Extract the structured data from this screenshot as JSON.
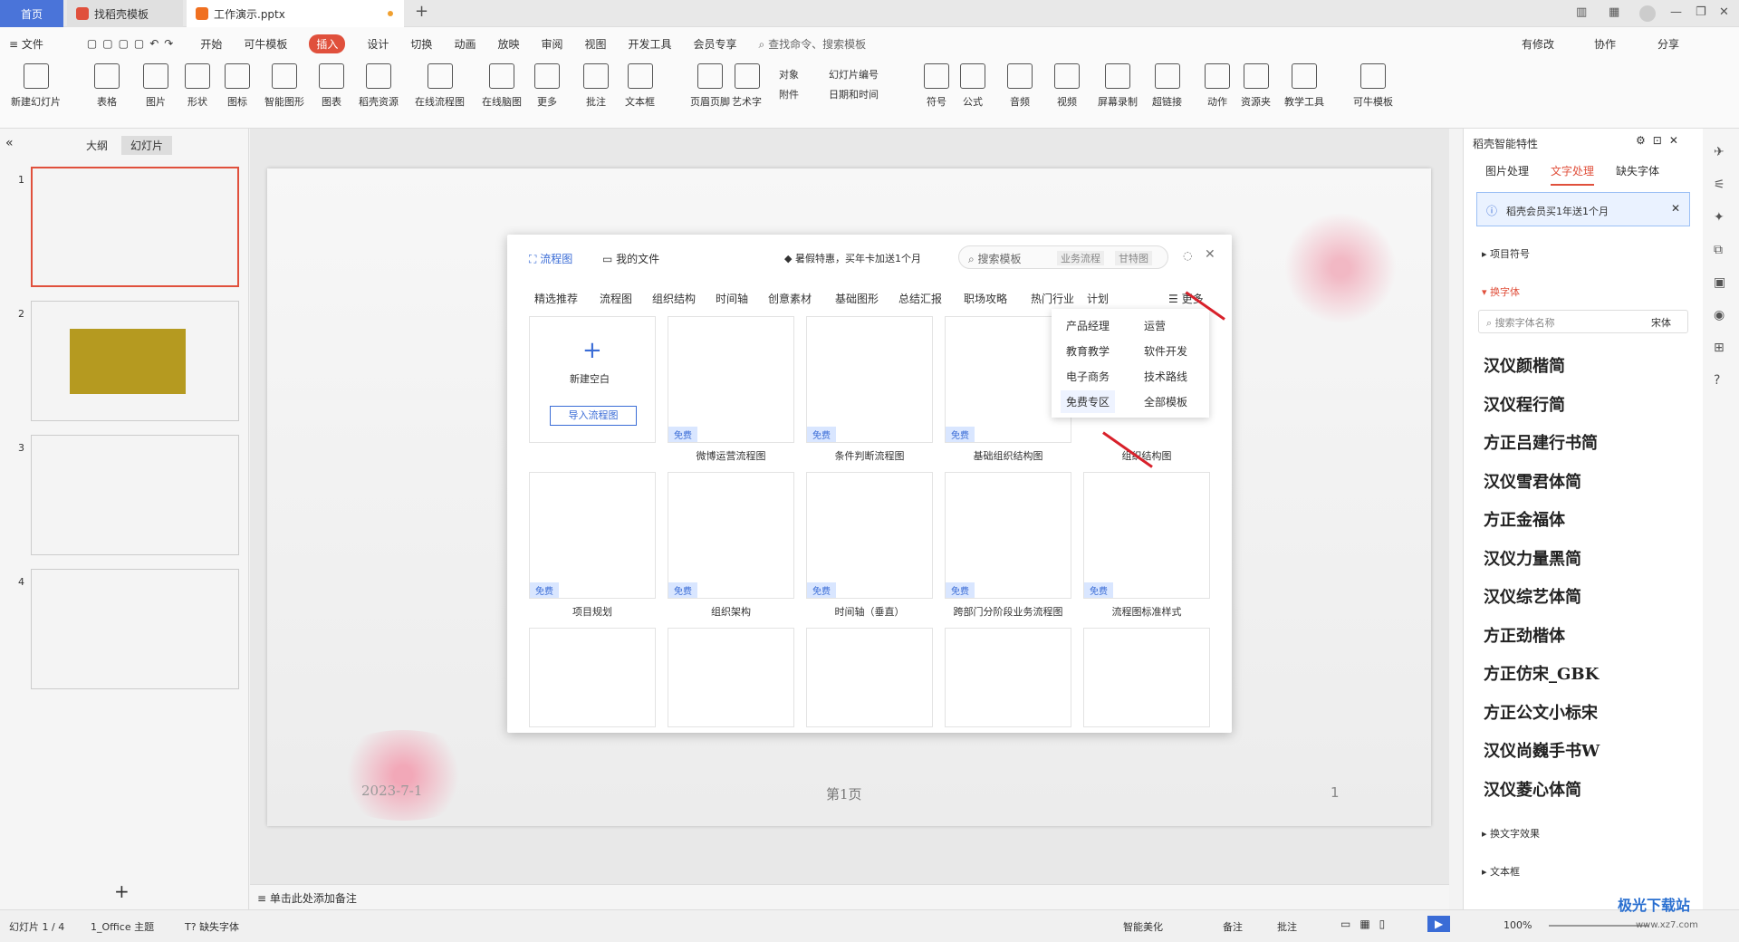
{
  "tabs": {
    "home": "首页",
    "t1": "找稻壳模板",
    "t2": "工作演示.pptx"
  },
  "menu": {
    "file": "文件",
    "items": [
      "开始",
      "可牛模板",
      "插入",
      "设计",
      "切换",
      "动画",
      "放映",
      "审阅",
      "视图",
      "开发工具",
      "会员专享"
    ],
    "search": "查找命令、搜索模板",
    "modified": "有修改",
    "collab": "协作",
    "share": "分享"
  },
  "ribbon": [
    "新建幻灯片",
    "表格",
    "图片",
    "形状",
    "图标",
    "智能图形",
    "图表",
    "稻壳资源",
    "在线流程图",
    "在线脑图",
    "更多",
    "批注",
    "文本框",
    "页眉页脚",
    "艺术字",
    "对象",
    "附件",
    "幻灯片编号",
    "日期和时间",
    "符号",
    "公式",
    "音频",
    "视频",
    "屏幕录制",
    "超链接",
    "动作",
    "资源夹",
    "教学工具",
    "可牛模板"
  ],
  "sidebar": {
    "outline": "大纲",
    "slides": "幻灯片",
    "nums": [
      "1",
      "2",
      "3",
      "4"
    ]
  },
  "slide": {
    "date": "2023-7-1",
    "page": "第1页",
    "num": "1"
  },
  "dialog": {
    "tab1": "流程图",
    "tab2": "我的文件",
    "promo": "暑假特惠，买年卡加送1个月",
    "search": "搜索模板",
    "tag1": "业务流程",
    "tag2": "甘特图",
    "cats": [
      "精选推荐",
      "流程图",
      "组织结构",
      "时间轴",
      "创意素材",
      "基础图形",
      "总结汇报",
      "职场攻略",
      "热门行业",
      "计划"
    ],
    "more": "更多",
    "new": "新建空白",
    "import": "导入流程图",
    "free": "免费",
    "row1": [
      "微博运营流程图",
      "条件判断流程图",
      "基础组织结构图",
      "组织结构图"
    ],
    "row2": [
      "项目规划",
      "组织架构",
      "时间轴（垂直）",
      "跨部门分阶段业务流程图",
      "流程图标准样式"
    ]
  },
  "dropdown": [
    "产品经理",
    "运营",
    "教育教学",
    "软件开发",
    "电子商务",
    "技术路线",
    "免费专区",
    "全部模板"
  ],
  "rpanel": {
    "title": "稻壳智能特性",
    "tabs": [
      "图片处理",
      "文字处理",
      "缺失字体"
    ],
    "notice": "稻壳会员买1年送1个月",
    "bullets": "项目符号",
    "changefont": "换字体",
    "fontsearch": "搜索字体名称",
    "fontdefault": "宋体",
    "fonts": [
      "汉仪颜楷简",
      "汉仪程行简",
      "方正吕建行书简",
      "汉仪雪君体简",
      "方正金福体",
      "汉仪力量黑简",
      "汉仪综艺体简",
      "方正劲楷体",
      "方正仿宋_GBK",
      "方正公文小标宋",
      "汉仪尚巍手书W",
      "汉仪菱心体简"
    ],
    "effects": "换文字效果",
    "textbox": "文本框"
  },
  "note": "单击此处添加备注",
  "status": {
    "slide": "幻灯片 1 / 4",
    "theme": "1_Office 主题",
    "missing": "缺失字体",
    "beautify": "智能美化",
    "notes": "备注",
    "comment": "批注",
    "zoom": "100%"
  },
  "watermark": "极光下载站",
  "watermark_url": "www.xz7.com"
}
